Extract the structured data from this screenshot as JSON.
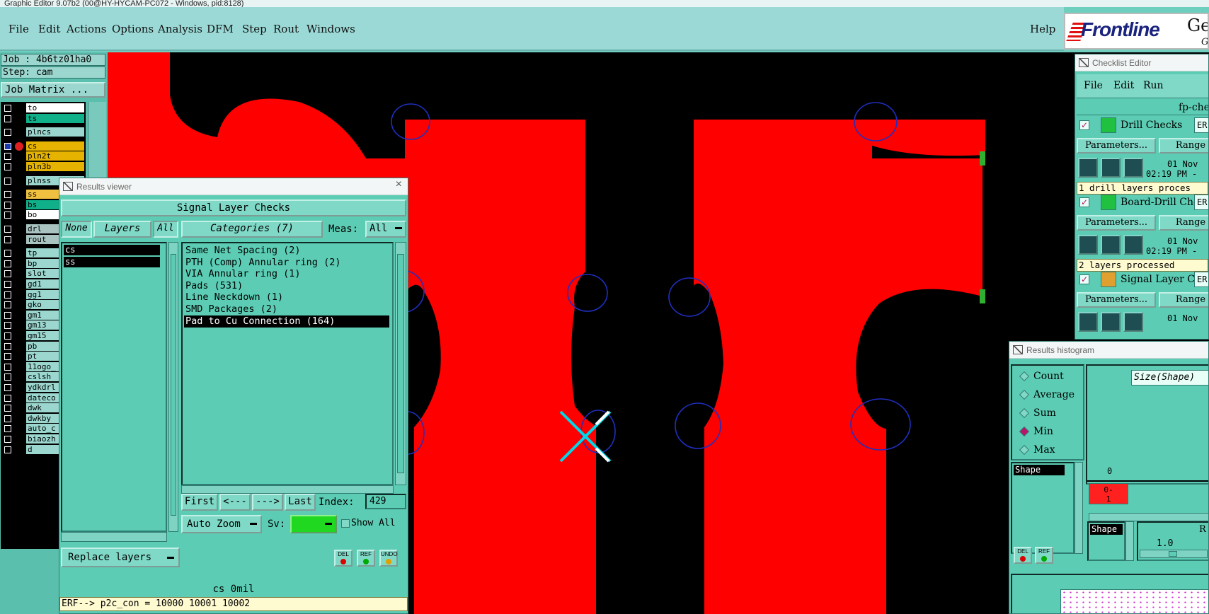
{
  "window": {
    "title": "Graphic Editor 9.07b2 (00@HY-HYCAM-PC072 - Windows, pid:8128)"
  },
  "menu": {
    "items": [
      "File",
      "Edit",
      "Actions",
      "Options",
      "Analysis",
      "DFM",
      "Step",
      "Rout",
      "Windows"
    ],
    "help": "Help"
  },
  "logo": {
    "brand": "Frontline",
    "suffix": "Ger",
    "sub": "Gr"
  },
  "left": {
    "job": "Job : 4b6tz01ha0",
    "step": "Step: cam",
    "job_matrix": "Job Matrix ...",
    "layers": [
      {
        "name": "to",
        "color": "#ffffff",
        "gap": false
      },
      {
        "name": "ts",
        "color": "#10b08a",
        "gap": false
      },
      {
        "name": "plncs",
        "color": "#9bd7cf",
        "gap": true
      },
      {
        "name": "cs",
        "color": "#e6b400",
        "gap": true,
        "active": true
      },
      {
        "name": "pln2t",
        "color": "#e6b400",
        "gap": false
      },
      {
        "name": "pln3b",
        "color": "#e6b400",
        "gap": false
      },
      {
        "name": "plnss",
        "color": "#9bd7cf",
        "gap": true
      },
      {
        "name": "ss",
        "color": "#f0c040",
        "gap": true
      },
      {
        "name": "bs",
        "color": "#10b08a",
        "gap": false
      },
      {
        "name": "bo",
        "color": "#ffffff",
        "gap": false
      },
      {
        "name": "drl",
        "color": "#a9c4c0",
        "gap": true
      },
      {
        "name": "rout",
        "color": "#a9c4c0",
        "gap": false
      },
      {
        "name": "tp",
        "color": "#9bd7cf",
        "gap": true
      },
      {
        "name": "bp",
        "color": "#9bd7cf",
        "gap": false
      },
      {
        "name": "slot",
        "color": "#9bd7cf",
        "gap": false
      },
      {
        "name": "gd1",
        "color": "#9bd7cf",
        "gap": false
      },
      {
        "name": "gg1",
        "color": "#9bd7cf",
        "gap": false
      },
      {
        "name": "gko",
        "color": "#9bd7cf",
        "gap": false
      },
      {
        "name": "gm1",
        "color": "#9bd7cf",
        "gap": false
      },
      {
        "name": "gm13",
        "color": "#9bd7cf",
        "gap": false
      },
      {
        "name": "gm15",
        "color": "#9bd7cf",
        "gap": false
      },
      {
        "name": "pb",
        "color": "#9bd7cf",
        "gap": false
      },
      {
        "name": "pt",
        "color": "#9bd7cf",
        "gap": false
      },
      {
        "name": "11ogo_",
        "color": "#9bd7cf",
        "gap": false
      },
      {
        "name": "cslsh",
        "color": "#9bd7cf",
        "gap": false
      },
      {
        "name": "ydkdrl",
        "color": "#9bd7cf",
        "gap": false
      },
      {
        "name": "dateco",
        "color": "#9bd7cf",
        "gap": false
      },
      {
        "name": "dwk",
        "color": "#9bd7cf",
        "gap": false
      },
      {
        "name": "dwkby",
        "color": "#9bd7cf",
        "gap": false
      },
      {
        "name": "auto_c",
        "color": "#9bd7cf",
        "gap": false
      },
      {
        "name": "biaozh",
        "color": "#9bd7cf",
        "gap": false
      },
      {
        "name": "d",
        "color": "#9bd7cf",
        "gap": false
      }
    ]
  },
  "results_viewer": {
    "title": "Results viewer",
    "header": "Signal Layer Checks",
    "none": "None",
    "layers": "Layers",
    "all": "All",
    "categories_label": "Categories (7)",
    "meas_label": "Meas:",
    "meas_value": "All",
    "layer_items": [
      "cs",
      "ss"
    ],
    "categories": [
      "Same Net Spacing (2)",
      "PTH (Comp) Annular ring (2)",
      "VIA Annular ring (1)",
      "Pads (531)",
      "Line Neckdown (1)",
      "SMD Packages (2)",
      "Pad to Cu Connection (164)"
    ],
    "first": "First",
    "prev": "<---",
    "next": "--->",
    "last": "Last",
    "index_label": "Index:",
    "index_value": "429",
    "auto_zoom": "Auto Zoom",
    "sv": "Sv:",
    "show_all": "Show All",
    "replace_layers": "Replace layers",
    "del": "DEL",
    "ref": "REF",
    "undo": "UNDO",
    "layer_status": "cs 0mil",
    "erf_line": "ERF--> p2c_con = 10000 10001 10002"
  },
  "checklist": {
    "title": "Checklist Editor",
    "menu": [
      "File",
      "Edit",
      "Run"
    ],
    "name": "fp-che",
    "checks": [
      {
        "label": "Drill Checks",
        "er": "ER",
        "date": "01 Nov",
        "time": "02:19 PM -",
        "status": "1 drill layers proces"
      },
      {
        "label": "Board-Drill Che",
        "er": "ER",
        "date": "01 Nov",
        "time": "02:19 PM -",
        "status": "2 layers processed"
      },
      {
        "label": "Signal Layer Ch",
        "er": "ER",
        "date": "01 Nov",
        "time": "",
        "status": ""
      }
    ],
    "parameters": "Parameters...",
    "range": "Range"
  },
  "histogram": {
    "title": "Results histogram",
    "options": [
      "Count",
      "Average",
      "Sum",
      "Min",
      "Max"
    ],
    "selected": "Min",
    "size_btn": "Size(Shape) ",
    "shape_item": "Shape",
    "shape_label": "Shape",
    "axis_zero": "0",
    "bin_label_top": "0-",
    "bin_label_bottom": "1",
    "scale_value": "1.0",
    "scale_label": "R",
    "del": "DEL",
    "ref": "REF"
  }
}
